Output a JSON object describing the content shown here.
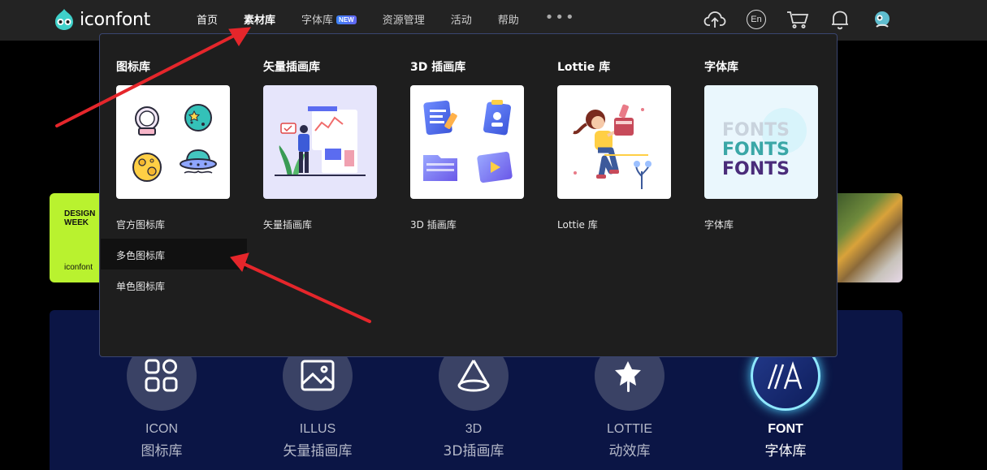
{
  "header": {
    "logo_text": "iconfont",
    "nav": [
      {
        "label": "首页"
      },
      {
        "label": "素材库"
      },
      {
        "label": "字体库",
        "badge": "NEW"
      },
      {
        "label": "资源管理"
      },
      {
        "label": "活动"
      },
      {
        "label": "帮助"
      }
    ],
    "more": "•••",
    "lang": "En"
  },
  "dropdown": {
    "columns": [
      {
        "title": "图标库",
        "items": [
          "官方图标库",
          "多色图标库",
          "单色图标库"
        ]
      },
      {
        "title": "矢量插画库",
        "items": [
          "矢量插画库"
        ]
      },
      {
        "title": "3D 插画库",
        "items": [
          "3D 插画库"
        ]
      },
      {
        "title": "Lottie 库",
        "items": [
          "Lottie 库"
        ]
      },
      {
        "title": "字体库",
        "items": [
          "字体库"
        ]
      }
    ],
    "font_thumb_words": [
      "FONTS",
      "FONTS",
      "FONTS"
    ]
  },
  "banner_left": {
    "lines": [
      "DESIGN",
      "WEEK"
    ],
    "logo": "iconfont"
  },
  "categories": [
    {
      "en": "ICON",
      "zh": "图标库"
    },
    {
      "en": "ILLUS",
      "zh": "矢量插画库"
    },
    {
      "en": "3D",
      "zh": "3D插画库"
    },
    {
      "en": "LOTTIE",
      "zh": "动效库"
    },
    {
      "en": "FONT",
      "zh": "字体库"
    }
  ],
  "colors": {
    "accent_arrow": "#e5262b",
    "header_bg": "#232323",
    "dropdown_bg": "#1e1e1e",
    "panel_bg": "#0b1545"
  }
}
